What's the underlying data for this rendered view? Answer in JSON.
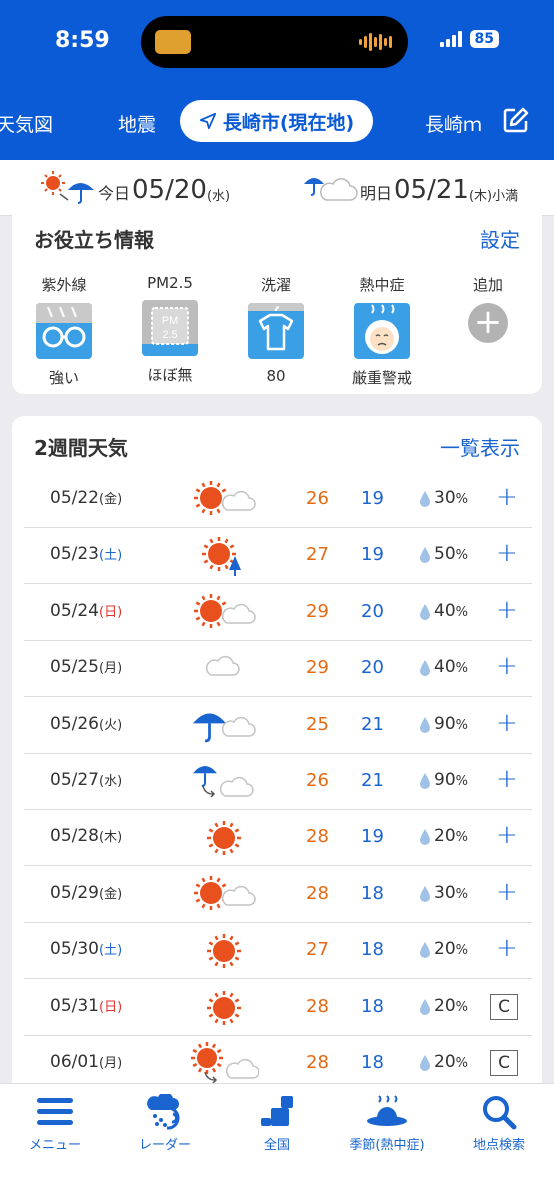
{
  "status": {
    "time": "8:59",
    "battery": "85"
  },
  "tabs": {
    "left1": "天気図",
    "left2": "地震",
    "active": "長崎市(現在地)",
    "right": "長崎ｍ"
  },
  "daybar": {
    "today": {
      "label": "今日",
      "date": "05/20",
      "weekday": "(水)"
    },
    "tomorrow": {
      "label": "明日",
      "date": "05/21",
      "weekday": "(木)",
      "extra": "小満"
    }
  },
  "useful": {
    "title": "お役立ち情報",
    "settings": "設定",
    "items": [
      {
        "title": "紫外線",
        "value": "強い",
        "icon": "glasses-icon"
      },
      {
        "title": "PM2.5",
        "value": "ほぼ無",
        "icon": "pm25-icon"
      },
      {
        "title": "洗濯",
        "value": "80",
        "icon": "laundry-icon"
      },
      {
        "title": "熱中症",
        "value": "厳重警戒",
        "icon": "heatstroke-icon"
      },
      {
        "title": "追加",
        "value": "",
        "icon": "plus-icon"
      }
    ]
  },
  "weekly": {
    "title": "2週間天気",
    "list_link": "一覧表示",
    "rows": [
      {
        "date": "05/22",
        "wd": "(金)",
        "wdtype": "",
        "icon": "sun-cloud",
        "hi": "26",
        "lo": "19",
        "pop": "30",
        "action": "+"
      },
      {
        "date": "05/23",
        "wd": "(土)",
        "wdtype": "sat",
        "icon": "sun-rain",
        "hi": "27",
        "lo": "19",
        "pop": "50",
        "action": "+"
      },
      {
        "date": "05/24",
        "wd": "(日)",
        "wdtype": "sun",
        "icon": "sun-cloud",
        "hi": "29",
        "lo": "20",
        "pop": "40",
        "action": "+"
      },
      {
        "date": "05/25",
        "wd": "(月)",
        "wdtype": "",
        "icon": "cloud",
        "hi": "29",
        "lo": "20",
        "pop": "40",
        "action": "+"
      },
      {
        "date": "05/26",
        "wd": "(火)",
        "wdtype": "",
        "icon": "umbrella-cloud",
        "hi": "25",
        "lo": "21",
        "pop": "90",
        "action": "+"
      },
      {
        "date": "05/27",
        "wd": "(水)",
        "wdtype": "",
        "icon": "umbrella-then-cloud",
        "hi": "26",
        "lo": "21",
        "pop": "90",
        "action": "+"
      },
      {
        "date": "05/28",
        "wd": "(木)",
        "wdtype": "",
        "icon": "sun",
        "hi": "28",
        "lo": "19",
        "pop": "20",
        "action": "+"
      },
      {
        "date": "05/29",
        "wd": "(金)",
        "wdtype": "",
        "icon": "sun-cloud",
        "hi": "28",
        "lo": "18",
        "pop": "30",
        "action": "+"
      },
      {
        "date": "05/30",
        "wd": "(土)",
        "wdtype": "sat",
        "icon": "sun",
        "hi": "27",
        "lo": "18",
        "pop": "20",
        "action": "+"
      },
      {
        "date": "05/31",
        "wd": "(日)",
        "wdtype": "sun",
        "icon": "sun",
        "hi": "28",
        "lo": "18",
        "pop": "20",
        "action": "C"
      },
      {
        "date": "06/01",
        "wd": "(月)",
        "wdtype": "",
        "icon": "sun-then-cloud",
        "hi": "28",
        "lo": "18",
        "pop": "20",
        "action": "C"
      }
    ],
    "percent_unit": "%"
  },
  "nav": [
    {
      "label": "メニュー",
      "icon": "menu-icon"
    },
    {
      "label": "レーダー",
      "icon": "radar-icon"
    },
    {
      "label": "全国",
      "icon": "map-icon"
    },
    {
      "label": "季節(熱中症)",
      "icon": "hat-icon"
    },
    {
      "label": "地点検索",
      "icon": "search-icon"
    }
  ],
  "colors": {
    "brand": "#0b5bd6",
    "high": "#e36a13",
    "low": "#1a64d0"
  }
}
